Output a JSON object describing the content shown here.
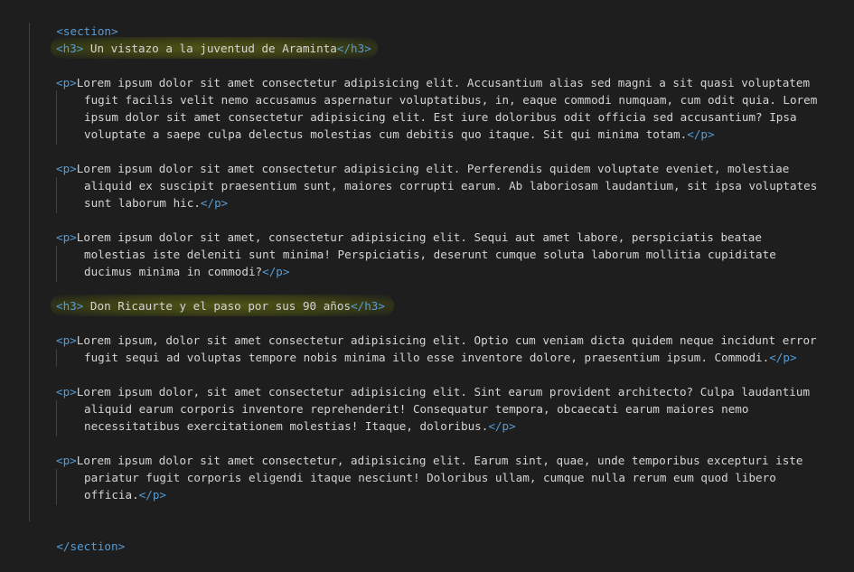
{
  "code": {
    "section_open": "<section>",
    "section_close": "</section>",
    "h3_open": "<h3>",
    "h3_close": "</h3>",
    "p_open": "<p>",
    "p_close": "</p>",
    "heading1": " Un vistazo a la juventud de Araminta",
    "heading2": " Don Ricaurte y el paso por sus 90 años",
    "p1": [
      "Lorem ipsum dolor sit amet consectetur adipisicing elit. Accusantium alias sed magni a sit quasi voluptatem",
      "fugit facilis velit nemo accusamus aspernatur voluptatibus, in, eaque commodi numquam, cum odit quia. Lorem",
      "ipsum dolor sit amet consectetur adipisicing elit. Est iure doloribus odit officia sed accusantium? Ipsa",
      "voluptate a saepe culpa delectus molestias cum debitis quo itaque. Sit qui minima totam."
    ],
    "p2": [
      "Lorem ipsum dolor sit amet consectetur adipisicing elit. Perferendis quidem voluptate eveniet, molestiae",
      "aliquid ex suscipit praesentium sunt, maiores corrupti earum. Ab laboriosam laudantium, sit ipsa voluptates",
      "sunt laborum hic."
    ],
    "p3": [
      "Lorem ipsum dolor sit amet, consectetur adipisicing elit. Sequi aut amet labore, perspiciatis beatae",
      "molestias iste deleniti sunt minima! Perspiciatis, deserunt cumque soluta laborum mollitia cupiditate",
      "ducimus minima in commodi?"
    ],
    "p4": [
      "Lorem ipsum, dolor sit amet consectetur adipisicing elit. Optio cum veniam dicta quidem neque incidunt error",
      "fugit sequi ad voluptas tempore nobis minima illo esse inventore dolore, praesentium ipsum. Commodi."
    ],
    "p5": [
      "Lorem ipsum dolor, sit amet consectetur adipisicing elit. Sint earum provident architecto? Culpa laudantium",
      "aliquid earum corporis inventore reprehenderit! Consequatur tempora, obcaecati earum maiores nemo",
      "necessitatibus exercitationem molestias! Itaque, doloribus."
    ],
    "p6": [
      "Lorem ipsum dolor sit amet consectetur, adipisicing elit. Earum sint, quae, unde temporibus excepturi iste",
      "pariatur fugit corporis eligendi itaque nesciunt! Doloribus ullam, cumque nulla rerum eum quod libero",
      "officia."
    ]
  },
  "colors": {
    "background": "#1e1e1e",
    "tag": "#569cd6",
    "text": "#d4d4d4",
    "heading_highlight": "#5a6410"
  }
}
